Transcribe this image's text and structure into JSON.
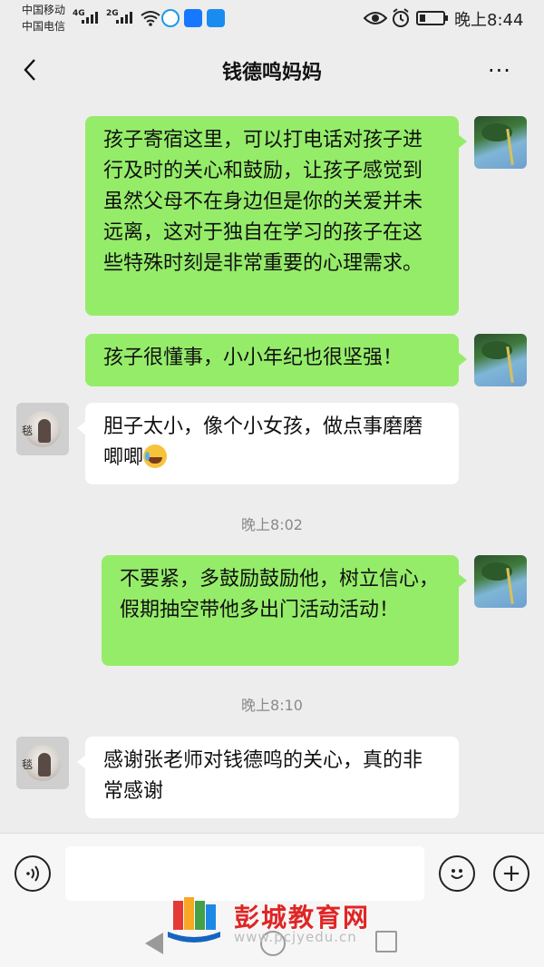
{
  "status_bar": {
    "carrier1": "中国移动",
    "carrier2": "中国电信",
    "net1": "4G",
    "net2": "2G",
    "time": "晚上8:44"
  },
  "header": {
    "title": "钱德鸣妈妈",
    "back_icon": "chevron-left-icon",
    "more_icon": "more-dots-icon",
    "more_label": "···"
  },
  "messages": [
    {
      "side": "me",
      "text": "孩子寄宿这里，可以打电话对孩子进行及时的关心和鼓励，让孩子感觉到虽然父母不在身边但是你的关爱并未远离，这对于独自在学习的孩子在这些特殊时刻是非常重要的心理需求。"
    },
    {
      "side": "me",
      "text": "孩子很懂事，小小年纪也很坚强！"
    },
    {
      "side": "other",
      "text": "胆子太小，像个小女孩，做点事磨磨唧唧",
      "avatar_char": "毯"
    },
    {
      "side": "me",
      "text": "不要紧，多鼓励鼓励他，树立信心，假期抽空带他多出门活动活动！"
    },
    {
      "side": "other",
      "text": "感谢张老师对钱德鸣的关心，真的非常感谢",
      "avatar_char": "毯"
    }
  ],
  "timestamps": [
    "晚上8:02",
    "晚上8:10"
  ],
  "input_bar": {
    "voice_icon": "voice-icon",
    "emoji_icon": "smile-icon",
    "plus_label": "+"
  },
  "watermark": {
    "title": "彭城教育网",
    "url": "www.pcjyedu.cn"
  },
  "colors": {
    "my_bubble": "#95ec69",
    "other_bubble": "#ffffff",
    "background": "#ededed"
  }
}
